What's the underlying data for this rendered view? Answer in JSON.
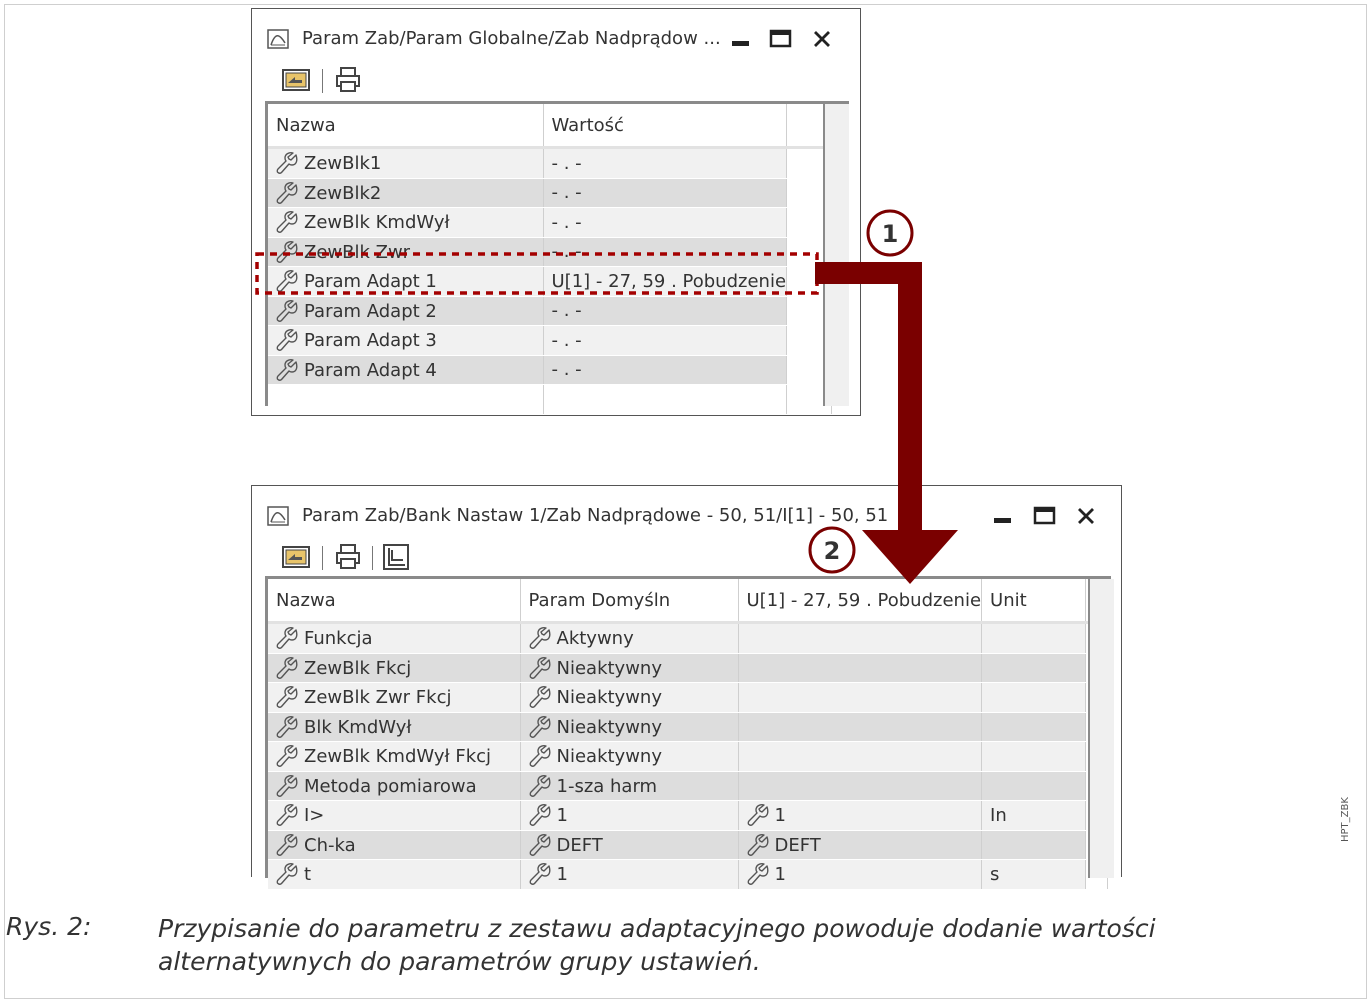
{
  "window1": {
    "title": "Param Zab/Param Globalne/Zab Nadprądow ...",
    "columns": [
      "Nazwa",
      "Wartość"
    ],
    "rows": [
      {
        "name": "ZewBlk1",
        "value": "- . -"
      },
      {
        "name": "ZewBlk2",
        "value": "- . -"
      },
      {
        "name": "ZewBlk KmdWył",
        "value": "- . -"
      },
      {
        "name": "ZewBlk Zwr",
        "value": "- . -"
      },
      {
        "name": "Param Adapt 1",
        "value": "U[1] - 27, 59 . Pobudzenie"
      },
      {
        "name": "Param Adapt 2",
        "value": "- . -"
      },
      {
        "name": "Param Adapt 3",
        "value": "- . -"
      },
      {
        "name": "Param Adapt 4",
        "value": "- . -"
      }
    ]
  },
  "window2": {
    "title": "Param Zab/Bank Nastaw 1/Zab Nadprądowe - 50, 51/I[1] - 50, 51",
    "columns": [
      "Nazwa",
      "Param Domyśln",
      "U[1] - 27, 59 . Pobudzenie",
      "Unit"
    ],
    "rows": [
      {
        "name": "Funkcja",
        "default": "Aktywny",
        "adapt": "",
        "unit": ""
      },
      {
        "name": "ZewBlk Fkcj",
        "default": "Nieaktywny",
        "adapt": "",
        "unit": ""
      },
      {
        "name": "ZewBlk Zwr Fkcj",
        "default": "Nieaktywny",
        "adapt": "",
        "unit": ""
      },
      {
        "name": "Blk KmdWył",
        "default": "Nieaktywny",
        "adapt": "",
        "unit": ""
      },
      {
        "name": "ZewBlk KmdWył Fkcj",
        "default": "Nieaktywny",
        "adapt": "",
        "unit": ""
      },
      {
        "name": "Metoda pomiarowa",
        "default": "1-sza harm",
        "adapt": "",
        "unit": ""
      },
      {
        "name": "I>",
        "default": "1",
        "adapt": "1",
        "unit": "In"
      },
      {
        "name": "Ch-ka",
        "default": "DEFT",
        "adapt": "DEFT",
        "unit": ""
      },
      {
        "name": "t",
        "default": "1",
        "adapt": "1",
        "unit": "s"
      }
    ]
  },
  "callouts": {
    "one": "1",
    "two": "2"
  },
  "caption": {
    "number": "Rys. 2:",
    "text": "Przypisanie do parametru z zestawu adaptacyjnego powoduje dodanie wartości alternatywnych do parametrów grupy ustawień."
  },
  "side_label": "HPT_ZBK",
  "colors": {
    "arrow": "#7a0000",
    "highlight_dash": "#a40000",
    "row_light": "#f1f1f1",
    "row_dark": "#dddddd"
  }
}
